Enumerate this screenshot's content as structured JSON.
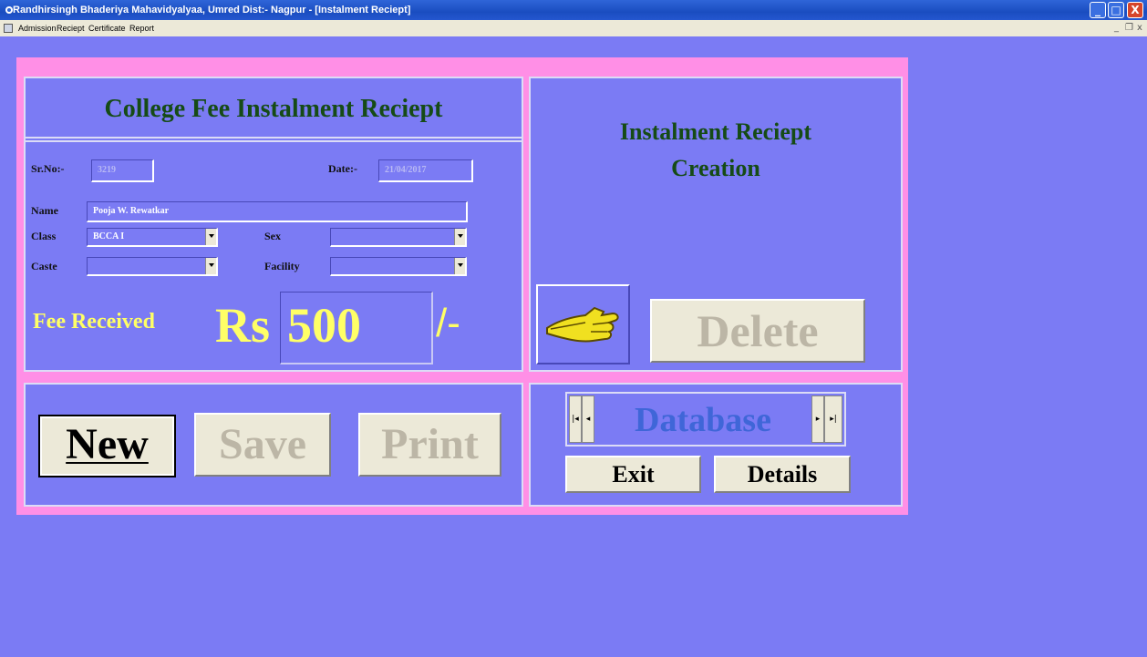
{
  "window": {
    "title": "Randhirsingh Bhaderiya Mahavidyalyaa, Umred Dist:- Nagpur - [Instalment Reciept]",
    "min_glyph": "_",
    "max_glyph": "□",
    "close_glyph": "X"
  },
  "menu": {
    "items": [
      "Admission",
      "Reciept",
      "Certificate",
      "Report"
    ],
    "mdi_min": "_",
    "mdi_restore": "❐",
    "mdi_close": "x"
  },
  "form": {
    "title": "College Fee Instalment Reciept",
    "srno_label": "Sr.No:-",
    "srno_value": "3219",
    "date_label": "Date:-",
    "date_value": "21/04/2017",
    "name_label": "Name",
    "name_value": "Pooja W. Rewatkar",
    "class_label": "Class",
    "class_value": "BCCA I",
    "sex_label": "Sex",
    "sex_value": "",
    "caste_label": "Caste",
    "caste_value": "",
    "facility_label": "Facility",
    "facility_value": "",
    "fee_label": "Fee Received",
    "currency": "Rs",
    "amount": "500",
    "suffix": "/-"
  },
  "right": {
    "title_line1": "Instalment Reciept",
    "title_line2": "Creation",
    "delete_label": "Delete"
  },
  "actions": {
    "new_label": "New",
    "save_label": "Save",
    "print_label": "Print"
  },
  "nav": {
    "database_label": "Database",
    "first_glyph": "|◂",
    "prev_glyph": "◂",
    "next_glyph": "▸",
    "last_glyph": "▸|",
    "exit_label": "Exit",
    "details_label": "Details"
  },
  "colors": {
    "background": "#7b7bf4",
    "frame": "#ff8fe6",
    "title_green": "#164b16",
    "fee_yellow": "#ffff66",
    "button_face": "#ece9d8"
  }
}
